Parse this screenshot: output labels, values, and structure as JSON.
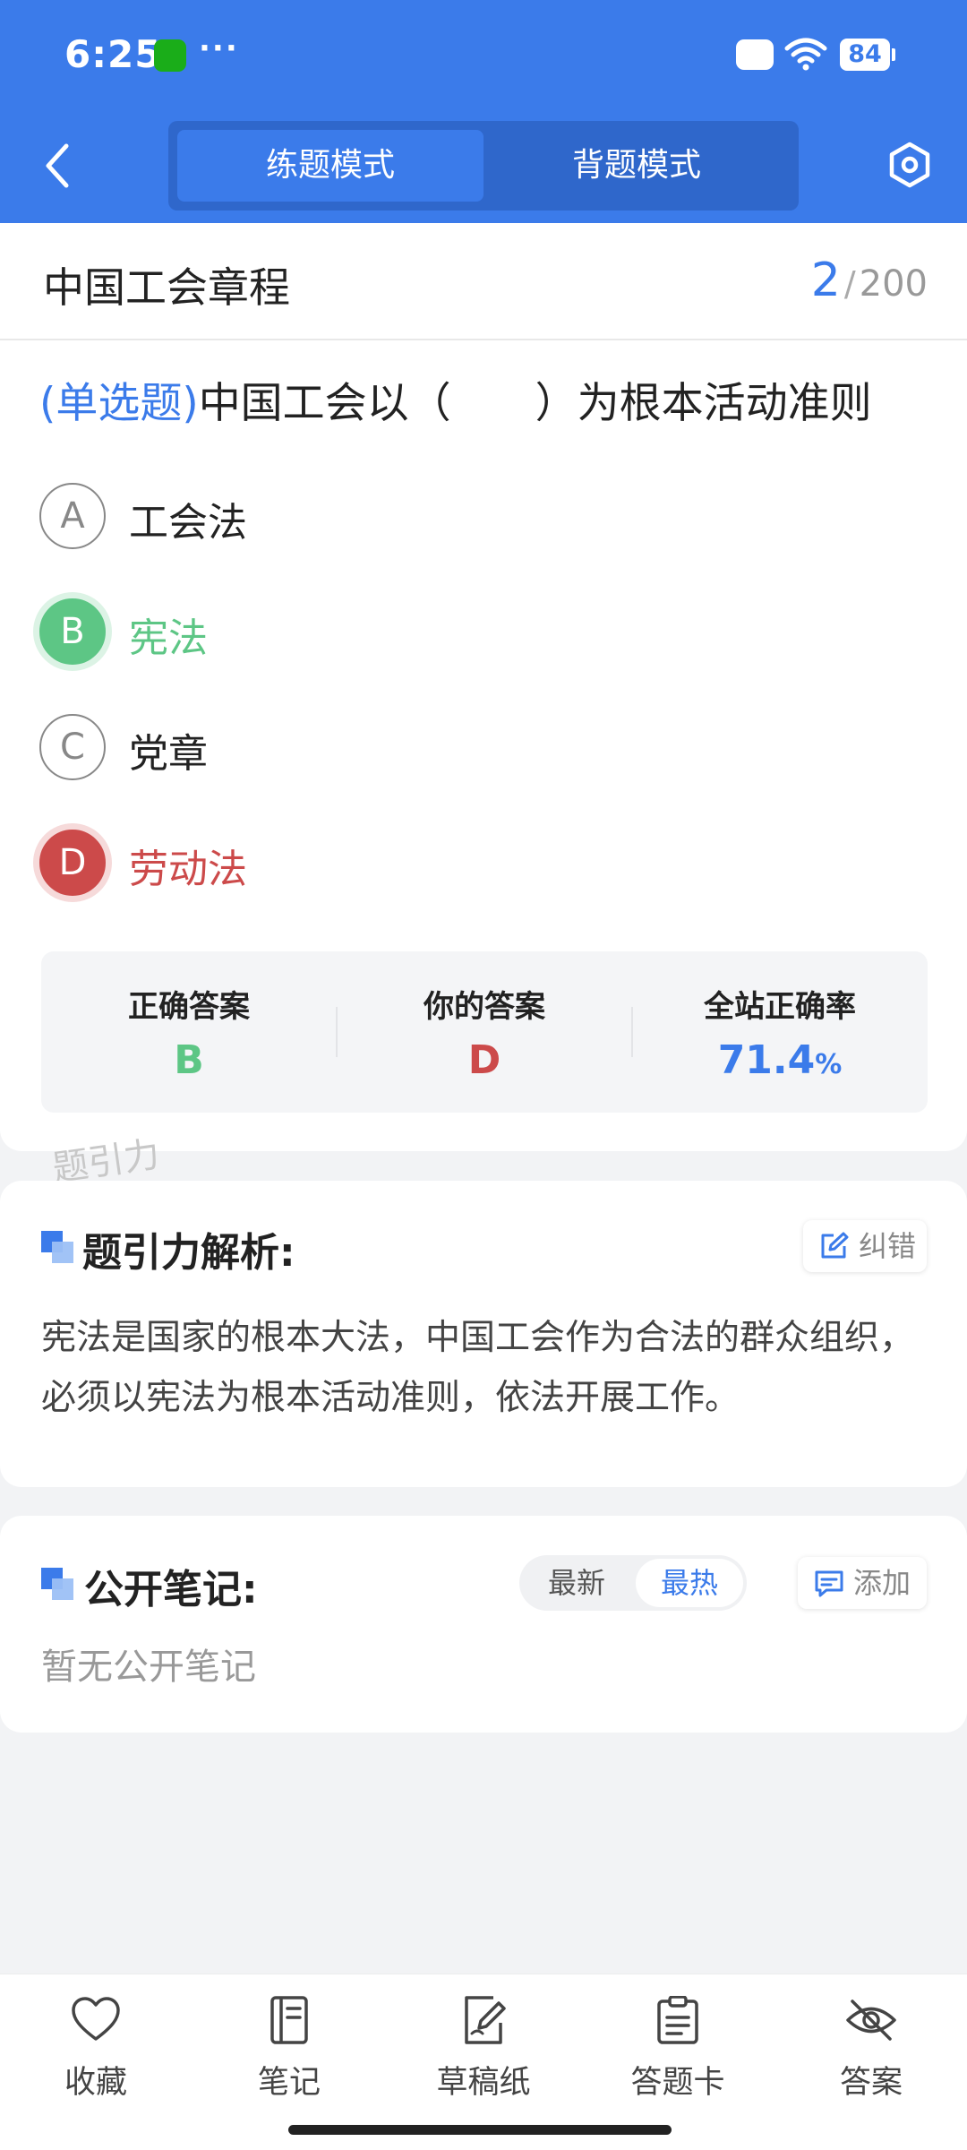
{
  "status_bar": {
    "time": "6:25",
    "dots": "···",
    "battery": "84"
  },
  "nav": {
    "modes": [
      "练题模式",
      "背题模式"
    ],
    "active_mode": "练题模式"
  },
  "chapter": {
    "title": "中国工会章程",
    "current": "2",
    "separator": "/",
    "total": "200"
  },
  "question": {
    "type": "(单选题)",
    "text": "中国工会以（　　）为根本活动准则"
  },
  "options": [
    {
      "letter": "A",
      "text": "工会法",
      "state": "normal"
    },
    {
      "letter": "B",
      "text": "宪法",
      "state": "correct"
    },
    {
      "letter": "C",
      "text": "党章",
      "state": "normal"
    },
    {
      "letter": "D",
      "text": "劳动法",
      "state": "wrong"
    }
  ],
  "stats": {
    "correct_label": "正确答案",
    "correct_value": "B",
    "your_label": "你的答案",
    "your_value": "D",
    "rate_label": "全站正确率",
    "rate_value": "71.4",
    "rate_unit": "%"
  },
  "watermark": "题引力",
  "analysis": {
    "title": "题引力解析:",
    "report_label": "纠错",
    "text": "宪法是国家的根本大法，中国工会作为合法的群众组织，必须以宪法为根本活动准则，依法开展工作。"
  },
  "notes": {
    "title": "公开笔记:",
    "sort_newest": "最新",
    "sort_hottest": "最热",
    "active_sort": "最热",
    "add_label": "添加",
    "empty_text": "暂无公开笔记"
  },
  "bottom_bar": {
    "favorite": "收藏",
    "notes": "笔记",
    "scratch": "草稿纸",
    "answer_card": "答题卡",
    "answer": "答案"
  },
  "colors": {
    "primary": "#3b7bea",
    "correct": "#5dc685",
    "wrong": "#cc4a4a"
  }
}
